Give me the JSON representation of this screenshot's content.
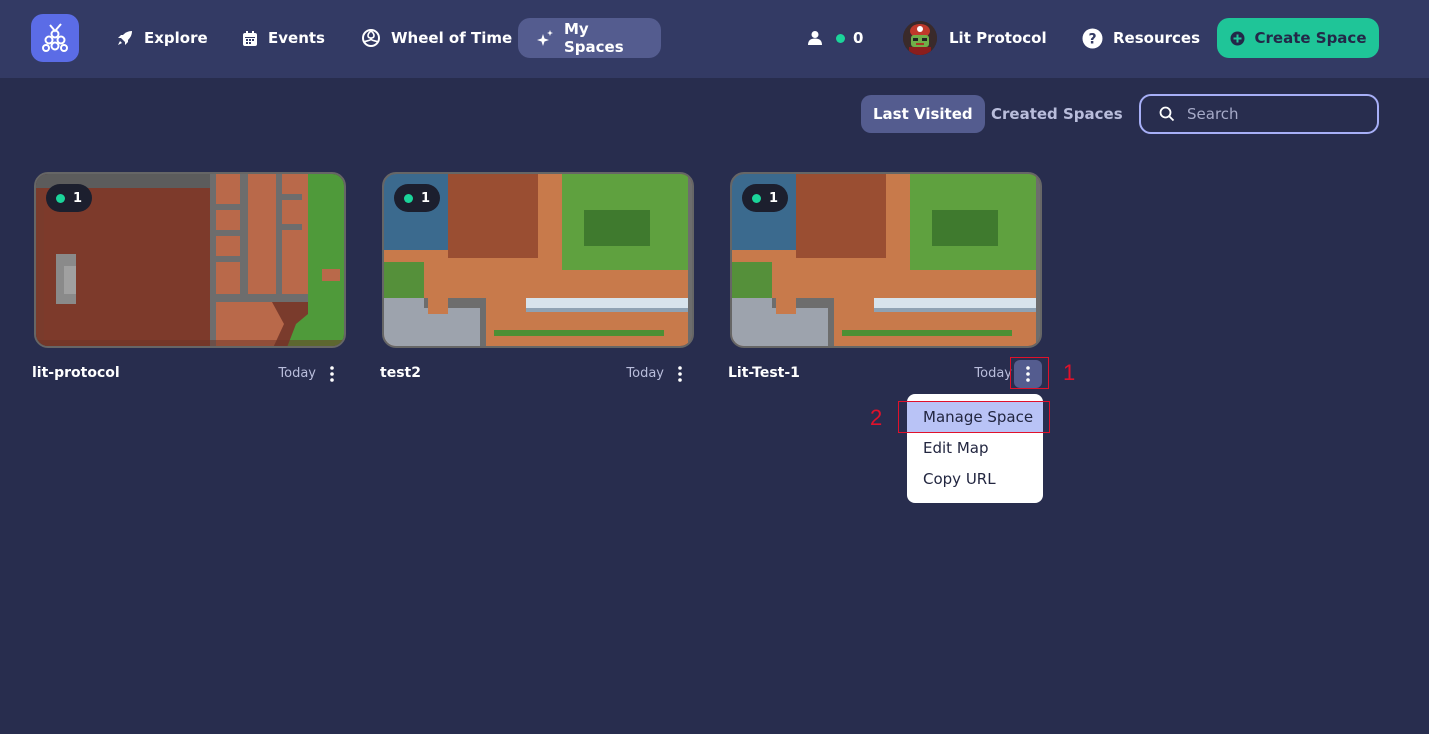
{
  "nav": {
    "logo_icon": "gather-grapes-icon",
    "items": [
      {
        "label": "Explore",
        "icon": "rocket-icon"
      },
      {
        "label": "Events",
        "icon": "calendar-icon"
      },
      {
        "label": "Wheel of Time",
        "icon": "wheel-icon"
      },
      {
        "label": "My Spaces",
        "icon": "sparkle-icon",
        "active": true
      }
    ],
    "online_count": "0",
    "profile_name": "Lit Protocol",
    "resources_label": "Resources",
    "create_label": "Create Space"
  },
  "filters": {
    "tabs": [
      {
        "label": "Last Visited",
        "active": true
      },
      {
        "label": "Created Spaces",
        "active": false
      }
    ],
    "search_placeholder": "Search"
  },
  "spaces": [
    {
      "name": "lit-protocol",
      "date": "Today",
      "online": "1"
    },
    {
      "name": "test2",
      "date": "Today",
      "online": "1"
    },
    {
      "name": "Lit-Test-1",
      "date": "Today",
      "online": "1"
    }
  ],
  "menu": {
    "items": [
      "Manage Space",
      "Edit Map",
      "Copy URL"
    ]
  },
  "annotations": [
    "1",
    "2"
  ],
  "colors": {
    "background": "#282d4e",
    "topbar": "#333a64",
    "accent": "#1fc598",
    "active_nav": "#545c8f",
    "annotation": "#e0112b"
  }
}
